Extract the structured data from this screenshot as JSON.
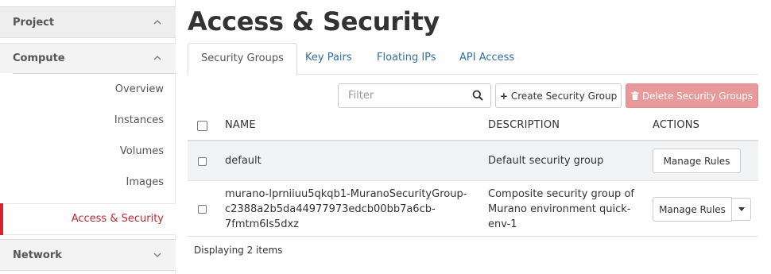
{
  "sidebar": {
    "project_label": "Project",
    "compute_label": "Compute",
    "network_label": "Network",
    "items": [
      {
        "label": "Overview"
      },
      {
        "label": "Instances"
      },
      {
        "label": "Volumes"
      },
      {
        "label": "Images"
      },
      {
        "label": "Access & Security"
      }
    ],
    "chevron_up": "⌃",
    "chevron_down": "⌄"
  },
  "main": {
    "title": "Access & Security",
    "tabs": [
      {
        "label": "Security Groups"
      },
      {
        "label": "Key Pairs"
      },
      {
        "label": "Floating IPs"
      },
      {
        "label": "API Access"
      }
    ],
    "filter": {
      "placeholder": "Filter"
    },
    "create_button": "Create Security Group",
    "delete_button": "Delete Security Groups",
    "table": {
      "headers": [
        "NAME",
        "DESCRIPTION",
        "ACTIONS"
      ],
      "rows": [
        {
          "name": "default",
          "description": "Default security group",
          "action": "Manage Rules"
        },
        {
          "name_lines": [
            "murano-lprniiuu5qkqb1-MuranoSecurityGroup-",
            "c2388a2b5da44977973edcb00bb7a6cb-",
            "7fmtm6ls5dxz"
          ],
          "description_lines": [
            "Composite security group of",
            "Murano environment quick-",
            "env-1"
          ],
          "action": "Manage Rules"
        }
      ],
      "footer": "Displaying 2 items"
    }
  },
  "colors": {
    "link": "#2f6fa8",
    "active_nav": "#c1272d",
    "danger_button": "#e89a9a"
  }
}
